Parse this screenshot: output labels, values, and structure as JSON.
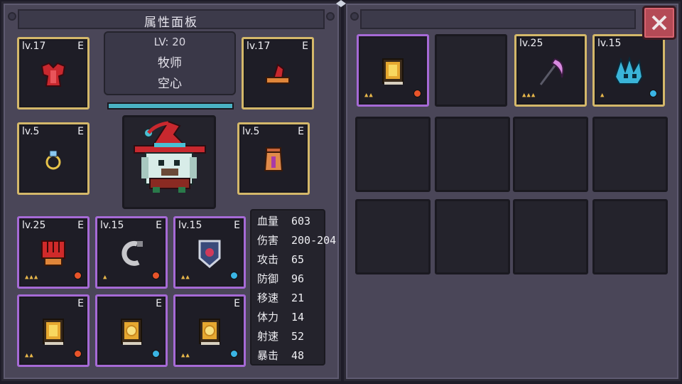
{
  "panel_title": "属性面板",
  "character": {
    "level_label": "LV: 20",
    "class_name": "牧师",
    "sub_name": "空心",
    "hp_fill": 1.0
  },
  "equipment": [
    {
      "id": "helmet",
      "level": "lv.17",
      "tag": "E",
      "icon": "red-armor-icon",
      "rarity": "gold"
    },
    {
      "id": "hat",
      "level": "lv.17",
      "tag": "E",
      "icon": "red-hat-icon",
      "rarity": "gold"
    },
    {
      "id": "ring",
      "level": "lv.5",
      "tag": "E",
      "icon": "ring-icon",
      "rarity": "gold"
    },
    {
      "id": "cape",
      "level": "lv.5",
      "tag": "E",
      "icon": "cape-icon",
      "rarity": "gold"
    },
    {
      "id": "gauntlet",
      "level": "lv.25",
      "tag": "E",
      "icon": "red-gauntlet-icon",
      "stars": "▲▲▲",
      "gem": "#e8542a"
    },
    {
      "id": "hook",
      "level": "lv.15",
      "tag": "E",
      "icon": "hook-icon",
      "stars": "▲",
      "gem": "#e8542a"
    },
    {
      "id": "shield",
      "level": "lv.15",
      "tag": "E",
      "icon": "shield-icon",
      "stars": "▲▲",
      "gem": "#3ab4e4"
    },
    {
      "id": "book1",
      "level": "",
      "tag": "E",
      "icon": "gold-book-icon",
      "stars": "▲▲",
      "gem": "#e8542a"
    },
    {
      "id": "book2",
      "level": "",
      "tag": "E",
      "icon": "sun-book-icon",
      "stars": "",
      "gem": "#3ab4e4"
    },
    {
      "id": "book3",
      "level": "",
      "tag": "E",
      "icon": "sun-book-icon",
      "stars": "▲▲",
      "gem": "#3ab4e4"
    }
  ],
  "stats": [
    {
      "label": "血量",
      "value": "603"
    },
    {
      "label": "伤害",
      "value": "200-204"
    },
    {
      "label": "攻击",
      "value": "65"
    },
    {
      "label": "防御",
      "value": "96"
    },
    {
      "label": "移速",
      "value": "21"
    },
    {
      "label": "体力",
      "value": "14"
    },
    {
      "label": "射速",
      "value": "52"
    },
    {
      "label": "暴击",
      "value": "48"
    }
  ],
  "inventory": [
    {
      "level": "",
      "icon": "gold-book-icon",
      "stars": "▲▲",
      "gem": "#e8542a",
      "rarity": "purple"
    },
    {
      "level": "",
      "icon": "",
      "stars": "",
      "gem": "",
      "rarity": "empty"
    },
    {
      "level": "lv.25",
      "icon": "scythe-icon",
      "stars": "▲▲▲",
      "gem": "",
      "rarity": "gold"
    },
    {
      "level": "lv.15",
      "icon": "crystal-dragon-icon",
      "stars": "▲",
      "gem": "#3ab4e4",
      "rarity": "gold"
    }
  ],
  "colors": {
    "gold_border": "#d4b86a",
    "purple_border": "#a66ad6",
    "hp_bar": "#4ab2c4",
    "close_button": "#b44a56"
  }
}
